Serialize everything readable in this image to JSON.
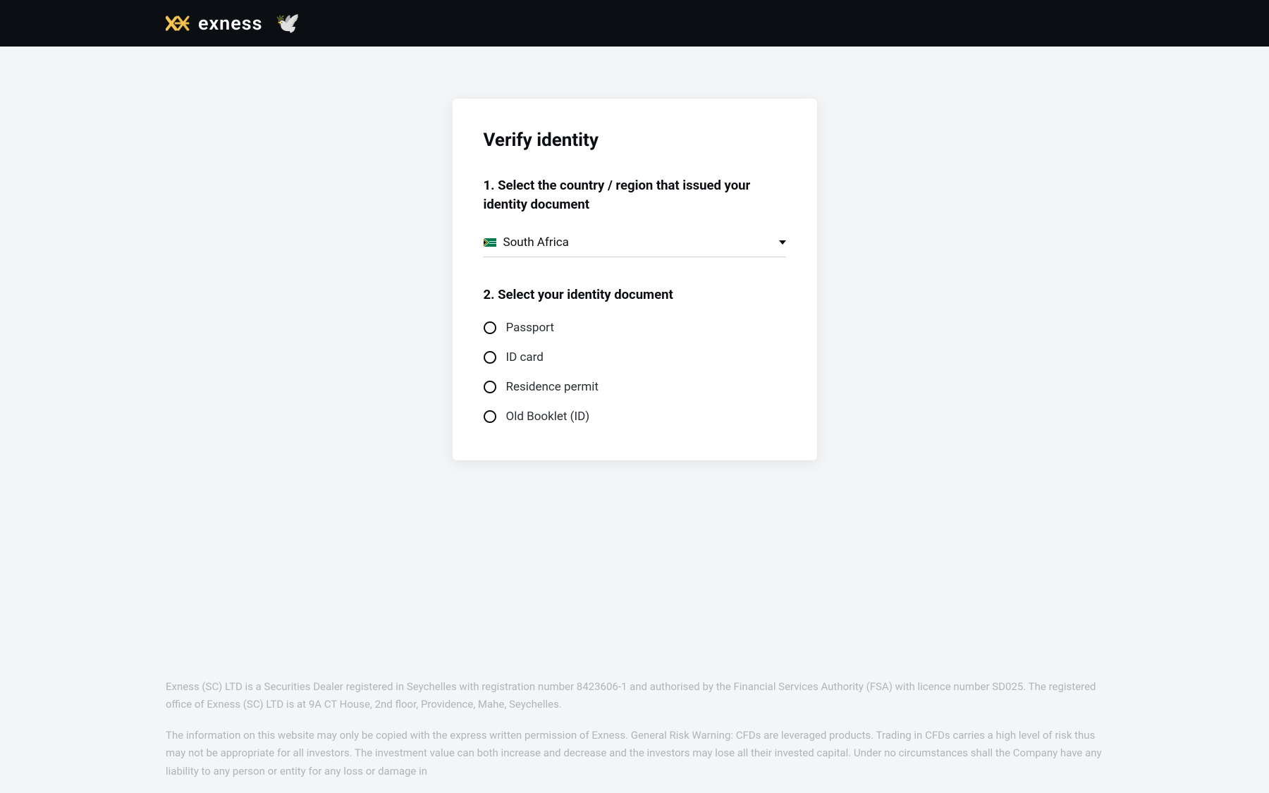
{
  "header": {
    "brand": "exness"
  },
  "card": {
    "title": "Verify identity",
    "step1_heading": "1. Select the country / region that issued your identity document",
    "country_selected": "South Africa",
    "step2_heading": "2. Select your identity document",
    "documents": [
      {
        "label": "Passport"
      },
      {
        "label": "ID card"
      },
      {
        "label": "Residence permit"
      },
      {
        "label": "Old Booklet (ID)"
      }
    ]
  },
  "footer": {
    "para1": "Exness (SC) LTD is a Securities Dealer registered in Seychelles with registration number 8423606-1 and authorised by the Financial Services Authority (FSA) with licence number SD025. The registered office of Exness (SC) LTD is at 9A CT House, 2nd floor, Providence, Mahe, Seychelles.",
    "para2": "The information on this website may only be copied with the express written permission of Exness. General Risk Warning: CFDs are leveraged products. Trading in CFDs carries a high level of risk thus may not be appropriate for all investors. The investment value can both increase and decrease and the investors may lose all their invested capital. Under no circumstances shall the Company have any liability to any person or entity for any loss or damage in"
  }
}
